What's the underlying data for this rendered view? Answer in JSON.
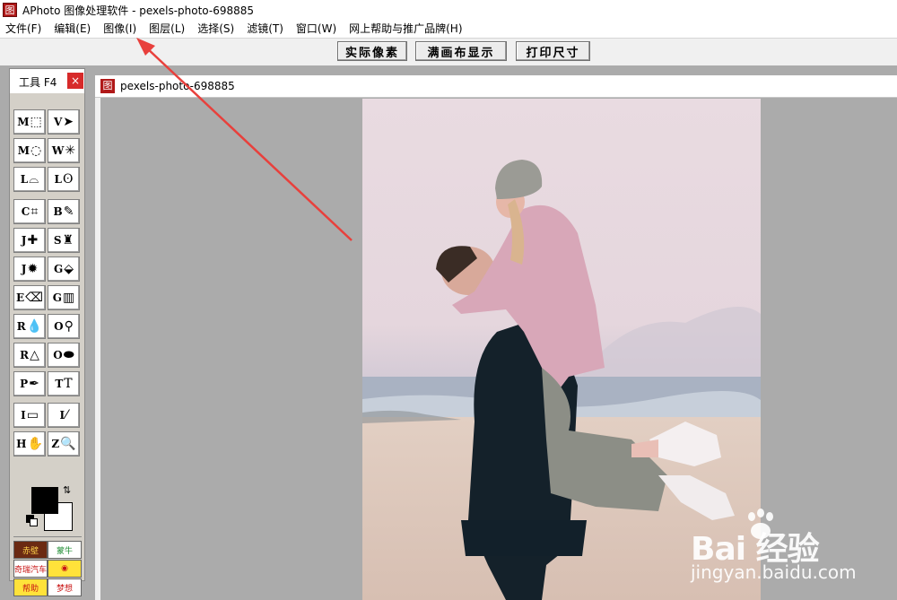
{
  "window": {
    "title": "APhoto 图像处理软件 - pexels-photo-698885",
    "app_icon_glyph": "图"
  },
  "menu": [
    {
      "label": "文件(F)"
    },
    {
      "label": "编辑(E)"
    },
    {
      "label": "图像(I)"
    },
    {
      "label": "图层(L)"
    },
    {
      "label": "选择(S)"
    },
    {
      "label": "滤镜(T)"
    },
    {
      "label": "窗口(W)"
    },
    {
      "label": "网上帮助与推广品牌(H)"
    }
  ],
  "toolbar": {
    "actual_pixels_label": "实际像素",
    "fit_canvas_label": "满画布显示",
    "print_size_label": "打印尺寸"
  },
  "tool_panel": {
    "title": "工具 F4",
    "close_glyph": "×",
    "tools": [
      {
        "key": "M",
        "glyph": "⬚",
        "icon": "rect-marquee-icon"
      },
      {
        "key": "V",
        "glyph": "➤",
        "icon": "move-icon"
      },
      {
        "key": "M",
        "glyph": "◌",
        "icon": "ellipse-marquee-icon"
      },
      {
        "key": "W",
        "glyph": "✳",
        "icon": "magic-wand-icon"
      },
      {
        "key": "L",
        "glyph": "⌓",
        "icon": "polygon-lasso-icon"
      },
      {
        "key": "L",
        "glyph": "ʘ",
        "icon": "lasso-icon"
      },
      {
        "key": "C",
        "glyph": "⌗",
        "icon": "crop-icon"
      },
      {
        "key": "B",
        "glyph": "✎",
        "icon": "brush-icon"
      },
      {
        "key": "J",
        "glyph": "✚",
        "icon": "healing-brush-icon"
      },
      {
        "key": "S",
        "glyph": "♜",
        "icon": "clone-stamp-icon"
      },
      {
        "key": "J",
        "glyph": "✹",
        "icon": "red-eye-icon"
      },
      {
        "key": "G",
        "glyph": "⬙",
        "icon": "paint-bucket-icon"
      },
      {
        "key": "E",
        "glyph": "⌫",
        "icon": "eraser-icon"
      },
      {
        "key": "G",
        "glyph": "▥",
        "icon": "gradient-icon"
      },
      {
        "key": "R",
        "glyph": "💧",
        "icon": "blur-icon"
      },
      {
        "key": "O",
        "glyph": "⚲",
        "icon": "dodge-icon"
      },
      {
        "key": "R",
        "glyph": "△",
        "icon": "sharpen-icon"
      },
      {
        "key": "O",
        "glyph": "⬬",
        "icon": "sponge-icon"
      },
      {
        "key": "P",
        "glyph": "✒",
        "icon": "pen-icon"
      },
      {
        "key": "T",
        "glyph": "T",
        "icon": "text-icon"
      },
      {
        "key": "I",
        "glyph": "▭",
        "icon": "ruler-icon"
      },
      {
        "key": "I",
        "glyph": "⁄",
        "icon": "eyedropper-icon"
      },
      {
        "key": "H",
        "glyph": "✋",
        "icon": "hand-icon"
      },
      {
        "key": "Z",
        "glyph": "🔍",
        "icon": "zoom-icon"
      }
    ],
    "foreground_color": "#000000",
    "background_color": "#ffffff",
    "ads": [
      {
        "text": "赤壁",
        "bg": "#6b2a12",
        "fg": "#ffd24a"
      },
      {
        "text": "蒙牛",
        "bg": "#ffffff",
        "fg": "#1a8a2e"
      },
      {
        "text": "奇瑞汽车",
        "bg": "#ffffff",
        "fg": "#c81414"
      },
      {
        "text": "◉",
        "bg": "#ffe23a",
        "fg": "#c81414"
      },
      {
        "text": "帮助",
        "bg": "#ffe23a",
        "fg": "#c81414"
      },
      {
        "text": "梦想",
        "bg": "#ffffff",
        "fg": "#c81414"
      }
    ]
  },
  "document": {
    "title": "pexels-photo-698885",
    "icon_glyph": "图"
  },
  "watermark": {
    "logo": "Bai  经验",
    "url": "jingyan.baidu.com"
  },
  "colors": {
    "annotation_arrow": "#e8403c",
    "title_icon": "#b01818",
    "close_button": "#d72a2a"
  }
}
